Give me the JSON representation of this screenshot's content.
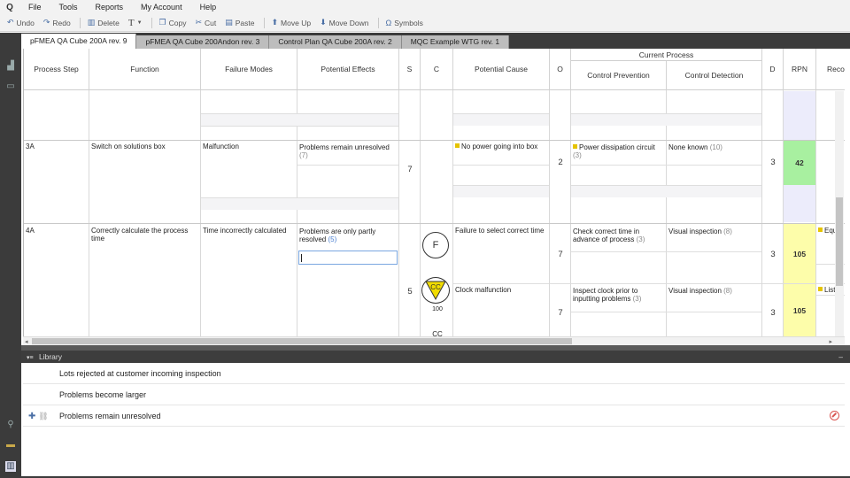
{
  "app": {
    "logo": "Q"
  },
  "menu": [
    "File",
    "Tools",
    "Reports",
    "My Account",
    "Help"
  ],
  "toolbar": [
    {
      "label": "Undo",
      "icon": "undo-icon"
    },
    {
      "label": "Redo",
      "icon": "redo-icon"
    },
    {
      "label": "Delete",
      "icon": "trash-icon"
    },
    {
      "label": "T",
      "icon": "text-format-icon"
    },
    {
      "label": "Copy",
      "icon": "copy-icon"
    },
    {
      "label": "Cut",
      "icon": "scissors-icon"
    },
    {
      "label": "Paste",
      "icon": "paste-icon"
    },
    {
      "label": "Move Up",
      "icon": "arrow-up-icon"
    },
    {
      "label": "Move Down",
      "icon": "arrow-down-icon"
    },
    {
      "label": "Symbols",
      "icon": "omega-icon"
    }
  ],
  "tabs": [
    "pFMEA QA Cube 200A rev. 9",
    "pFMEA QA Cube 200Andon rev. 3",
    "Control Plan QA Cube 200A rev. 2",
    "MQC Example WTG rev. 1"
  ],
  "headers": {
    "process_step": "Process Step",
    "function": "Function",
    "failure_modes": "Failure Modes",
    "potential_effects": "Potential Effects",
    "s": "S",
    "c": "C",
    "potential_cause": "Potential Cause",
    "o": "O",
    "current_process": "Current Process",
    "control_prevention": "Control Prevention",
    "control_detection": "Control Detection",
    "d": "D",
    "rpn": "RPN",
    "recommended": "Recon"
  },
  "rows": {
    "r3": {
      "step": "3A",
      "function": "Switch on solutions box",
      "failure_mode": "Malfunction",
      "effect": "Problems remain unresolved",
      "effect_count": "(7)",
      "severity": "7",
      "cause": "No power going into box",
      "occurrence": "2",
      "prevention": "Power dissipation circuit",
      "prevention_count": "(3)",
      "detection": "None known",
      "detection_count": "(10)",
      "d": "3",
      "rpn": "42"
    },
    "r4": {
      "step": "4A",
      "function": "Correctly calculate the process time",
      "failure_mode": "Time incorrectly calculated",
      "effect": "Problems are only partly resolved",
      "effect_count": "(5)",
      "severity": "5",
      "class_symbol": "F",
      "cc_symbol": "CC",
      "cc_value": "100",
      "cc_label": "CC",
      "cause1": "Failure to select correct time",
      "occurrence1": "7",
      "prevention1": "Check correct time in advance of process",
      "prevention1_count": "(3)",
      "detection1": "Visual inspection",
      "detection1_count": "(8)",
      "d1": "3",
      "rpn1": "105",
      "rec1": "Equ",
      "cause2": "Clock malfunction",
      "occurrence2": "7",
      "prevention2": "Inspect clock prior to inputting problems",
      "prevention2_count": "(3)",
      "detection2": "Visual inspection",
      "detection2_count": "(8)",
      "d2": "3",
      "rpn2": "105",
      "rec2": "List"
    }
  },
  "library": {
    "title": "Library",
    "items": [
      "Lots rejected at customer incoming inspection",
      "Problems become larger",
      "Problems remain unresolved"
    ]
  },
  "colors": {
    "rpn_green": "#a8f0a0",
    "rpn_yellow": "#fdfdaa",
    "rpn_empty": "#ececfb",
    "marker": "#e5c300"
  }
}
